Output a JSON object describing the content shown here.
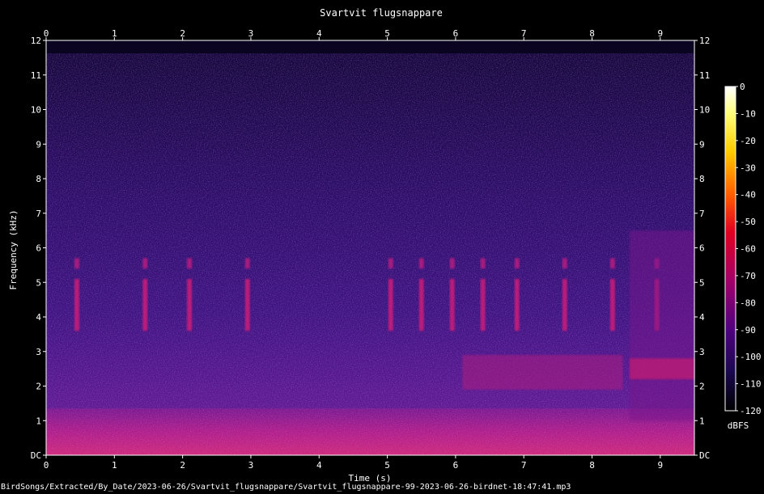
{
  "chart_data": {
    "type": "heatmap",
    "title": "Svartvit flugsnappare",
    "xlabel": "Time (s)",
    "ylabel": "Frequency (kHz)",
    "xlim": [
      0,
      9.5
    ],
    "ylim": [
      0,
      12
    ],
    "x_ticks": [
      "0",
      "1",
      "2",
      "3",
      "4",
      "5",
      "6",
      "7",
      "8",
      "9"
    ],
    "y_ticks": [
      "DC",
      "1",
      "2",
      "3",
      "4",
      "5",
      "6",
      "7",
      "8",
      "9",
      "10",
      "11",
      "12"
    ],
    "colorbar": {
      "label": "dBFS",
      "ticks": [
        "0",
        "-10",
        "-20",
        "-30",
        "-40",
        "-50",
        "-60",
        "-70",
        "-80",
        "-90",
        "-100",
        "-110",
        "-120"
      ],
      "range": [
        -120,
        0
      ]
    },
    "call_times_s": [
      0.45,
      1.45,
      2.1,
      2.95,
      5.05,
      5.5,
      5.95,
      6.4,
      6.9,
      7.6,
      8.3,
      8.95
    ],
    "colors": {
      "background": "#000000",
      "high_noise": "#1e0a4a",
      "mid_noise": "#4a1a8a",
      "low_band": "#c0207a",
      "peak": "#ffffff"
    }
  },
  "footer": "BirdSongs/Extracted/By_Date/2023-06-26/Svartvit_flugsnappare/Svartvit_flugsnappare-99-2023-06-26-birdnet-18:47:41.mp3"
}
